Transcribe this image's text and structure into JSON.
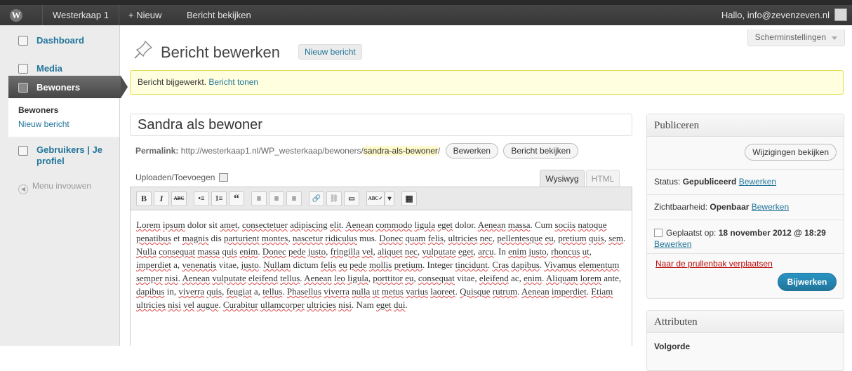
{
  "adminbar": {
    "site_name": "Westerkaap 1",
    "new_label": "+ Nieuw",
    "view_post_label": "Bericht bekijken",
    "greeting": "Hallo, info@zevenzeven.nl"
  },
  "sidebar": {
    "dashboard": "Dashboard",
    "media": "Media",
    "bewoners": "Bewoners",
    "submenu_title": "Bewoners",
    "submenu_new": "Nieuw bericht",
    "users": "Gebruikers | Je profiel",
    "collapse": "Menu invouwen"
  },
  "header": {
    "screen_options": "Scherminstellingen",
    "title": "Bericht bewerken",
    "new_post_button": "Nieuw bericht"
  },
  "notice": {
    "text": "Bericht bijgewerkt.",
    "link": "Bericht tonen"
  },
  "post": {
    "title": "Sandra als bewoner",
    "permalink_label": "Permalink:",
    "permalink_base": "http://westerkaap1.nl/WP_westerkaap/bewoners/",
    "permalink_slug": "sandra-als-bewoner",
    "permalink_trail": "/",
    "edit_button": "Bewerken",
    "view_button": "Bericht bekijken"
  },
  "editor": {
    "upload_label": "Uploaden/Toevoegen",
    "tab_visual": "Wysiwyg",
    "tab_html": "HTML",
    "toolbar": [
      "B",
      "I",
      "ABC",
      "•≡",
      "1≡",
      "“",
      "≡",
      "≡",
      "≡",
      "🔗",
      "⛓",
      "▭",
      "ABC✓",
      "▾",
      "▦"
    ]
  },
  "publish": {
    "title": "Publiceren",
    "preview_button": "Wijzigingen bekijken",
    "status_label": "Status:",
    "status_value": "Gepubliceerd",
    "visibility_label": "Zichtbaarheid:",
    "visibility_value": "Openbaar",
    "edit_link": "Bewerken",
    "date_label": "Geplaatst op:",
    "date_value": "18 november 2012 @ 18:29",
    "trash_link": "Naar de prullenbak verplaatsen",
    "update_button": "Bijwerken"
  },
  "attributes": {
    "title": "Attributen",
    "sub": "Volgorde"
  },
  "colors": {
    "link": "#21759b",
    "notice_bg": "#ffffe0",
    "trash": "#bc0b0b",
    "adminbar": "#464646"
  }
}
